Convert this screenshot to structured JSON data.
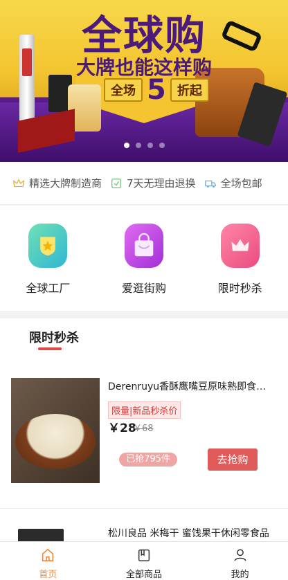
{
  "banner": {
    "title": "全球购",
    "subtitle": "大牌也能这样购",
    "promo_left": "全场",
    "promo_number": "5",
    "promo_right": "折起",
    "slide_count": 4,
    "active_slide": 1
  },
  "features": [
    {
      "icon": "crown-icon",
      "label": "精选大牌制造商"
    },
    {
      "icon": "return-icon",
      "label": "7天无理由退换"
    },
    {
      "icon": "truck-icon",
      "label": "全场包邮"
    }
  ],
  "categories": [
    {
      "icon": "factory-icon",
      "label": "全球工厂",
      "color": "#44c9c0"
    },
    {
      "icon": "shopping-bag-icon",
      "label": "爱逛街购",
      "color": "#c64ae6"
    },
    {
      "icon": "crown-icon",
      "label": "限时秒杀",
      "color": "#f25f92"
    }
  ],
  "flash_sale": {
    "title": "限时秒杀",
    "products": [
      {
        "name": "Derenruyu香酥鹰嘴豆原味熟即食新货…",
        "tag": "限量|新品秒杀价",
        "price": "￥28",
        "old_price": "￥68",
        "sold": "已抢795件",
        "buy_label": "去抢购"
      },
      {
        "name": "松川良品 米梅干 蜜饯果干休闲零食品"
      }
    ]
  },
  "tabbar": {
    "items": [
      {
        "icon": "home-icon",
        "label": "首页",
        "active": true
      },
      {
        "icon": "products-icon",
        "label": "全部商品",
        "active": false
      },
      {
        "icon": "user-icon",
        "label": "我的",
        "active": false
      }
    ],
    "active_color": "#f08a3c"
  }
}
